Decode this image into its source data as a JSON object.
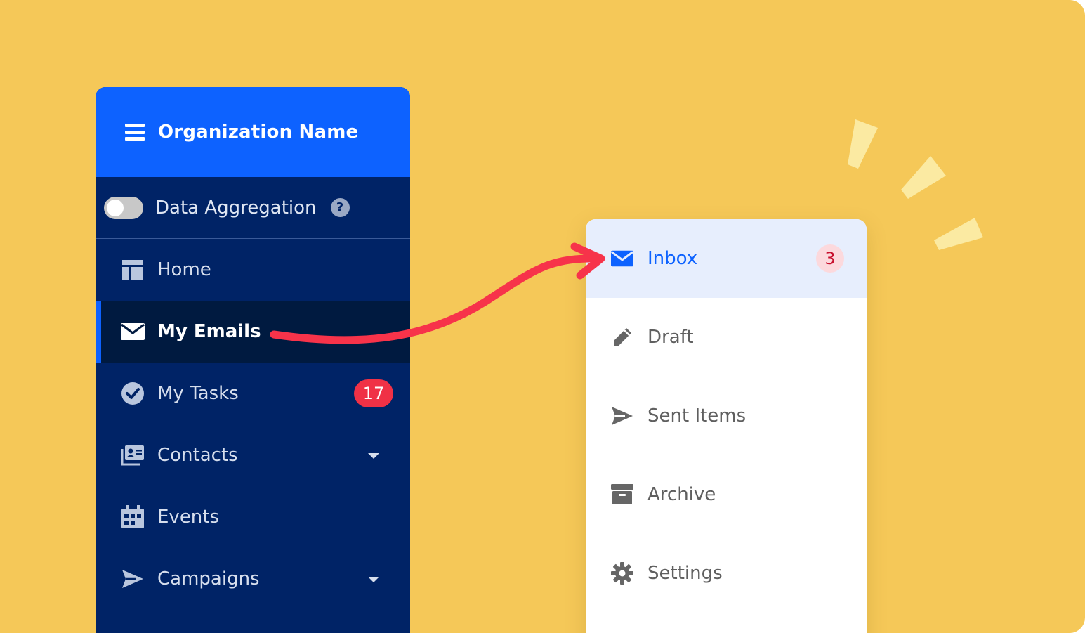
{
  "colors": {
    "background": "#f5c858",
    "sidebar_bg": "#002366",
    "header_bg": "#0d62ff",
    "active_item_bg": "#001a40",
    "badge_red": "#f03146",
    "arrow_red": "#f7334a",
    "panel_selected_bg": "#e7eefd"
  },
  "sidebar": {
    "header": {
      "title": "Organization Name",
      "icon": "hamburger-menu-icon"
    },
    "toggle": {
      "label": "Data Aggregation",
      "state": "off",
      "help_glyph": "?"
    },
    "items": [
      {
        "label": "Home",
        "icon": "dashboard-icon",
        "active": false
      },
      {
        "label": "My Emails",
        "icon": "envelope-icon",
        "active": true
      },
      {
        "label": "My Tasks",
        "icon": "check-circle-icon",
        "badge": "17"
      },
      {
        "label": "Contacts",
        "icon": "contact-card-icon",
        "expandable": true
      },
      {
        "label": "Events",
        "icon": "calendar-icon"
      },
      {
        "label": "Campaigns",
        "icon": "paper-plane-icon",
        "expandable": true
      }
    ]
  },
  "email_panel": {
    "items": [
      {
        "label": "Inbox",
        "icon": "envelope-icon",
        "selected": true,
        "badge": "3"
      },
      {
        "label": "Draft",
        "icon": "pencil-icon"
      },
      {
        "label": "Sent Items",
        "icon": "paper-plane-icon"
      },
      {
        "label": "Archive",
        "icon": "archive-box-icon"
      },
      {
        "label": "Settings",
        "icon": "gear-icon"
      }
    ]
  }
}
